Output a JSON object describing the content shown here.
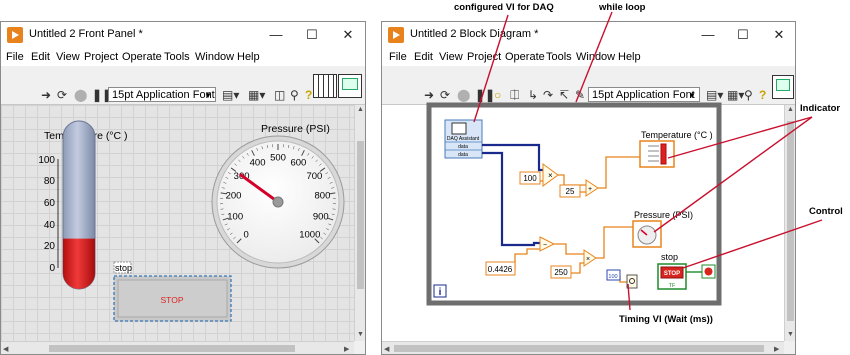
{
  "front_panel": {
    "title": "Untitled 2 Front Panel *",
    "menu": [
      "File",
      "Edit",
      "View",
      "Project",
      "Operate",
      "Tools",
      "Window",
      "Help"
    ],
    "font_selector": "15pt Application Font",
    "thermometer": {
      "label": "Temperature (°C )",
      "scale": [
        "100",
        "80",
        "60",
        "40",
        "20",
        "0"
      ],
      "value_fraction": 0.3
    },
    "gauge": {
      "label": "Pressure (PSI)",
      "scale": [
        "0",
        "100",
        "200",
        "300",
        "400",
        "500",
        "600",
        "700",
        "800",
        "900",
        "1000"
      ],
      "needle_value": 300
    },
    "stop_control": {
      "label": "stop",
      "button_text": "STOP"
    }
  },
  "block_diagram": {
    "title": "Untitled 2 Block Diagram *",
    "menu": [
      "File",
      "Edit",
      "View",
      "Project",
      "Operate",
      "Tools",
      "Window",
      "Help"
    ],
    "font_selector": "15pt Application Font",
    "daq": {
      "name": "DAQ Assistant",
      "outputs": [
        "data",
        "data"
      ]
    },
    "constants": [
      "100",
      "25",
      "0.4426",
      "250",
      "100"
    ],
    "temperature_label": "Temperature (°C )",
    "pressure_label": "Pressure (PSI)",
    "stop_label": "stop",
    "stop_button_text": "STOP",
    "tf_text": "TF",
    "loop_iteration": "i"
  },
  "annotations": {
    "daq": "configured VI for DAQ",
    "while_loop": "while loop",
    "indicator": "Indicator",
    "control": "Control",
    "timing": "Timing  VI (Wait (ms))"
  },
  "colors": {
    "thermometer_fill": "#e02020",
    "gauge_needle": "#d4002a",
    "stop_button": "#c9c9c9",
    "stop_text": "#d8241e",
    "wire_numeric": "#e8841c",
    "wire_dynamic": "#1a2a8c",
    "annotation_line": "#c8102e"
  }
}
